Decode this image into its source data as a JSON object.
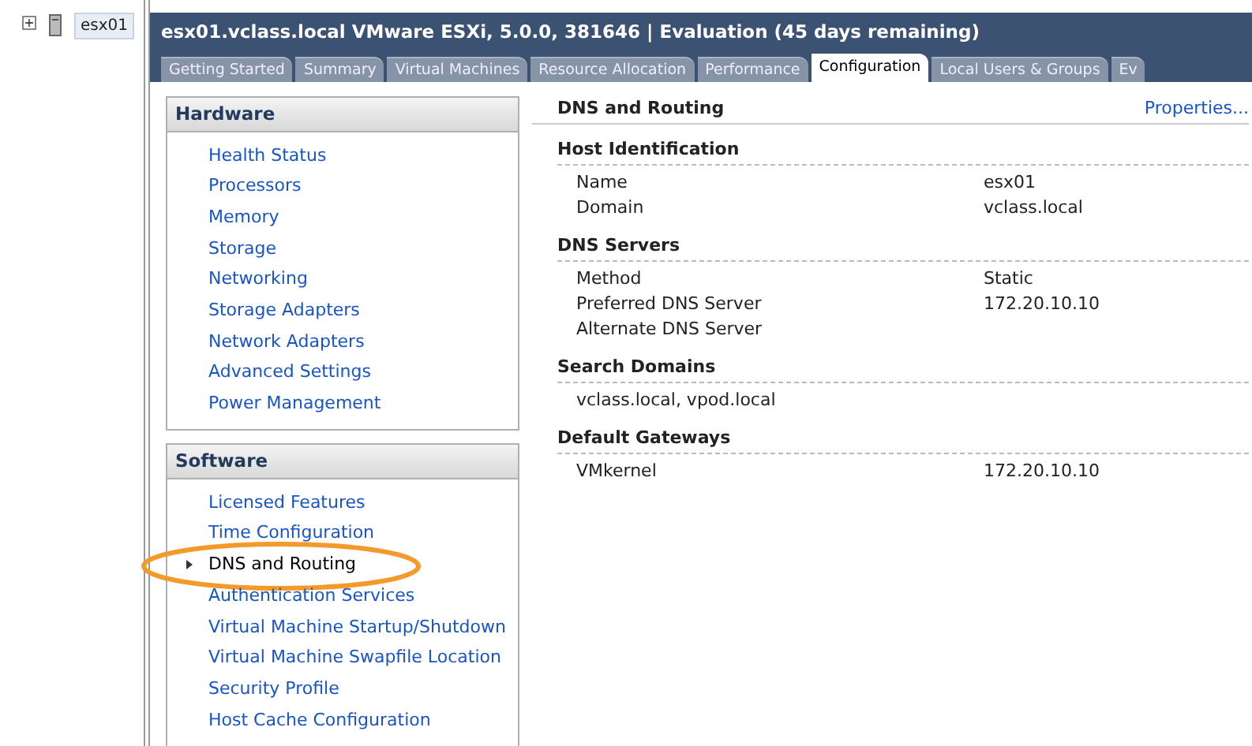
{
  "tree": {
    "expand_sign": "+",
    "host": "esx01"
  },
  "header": {
    "title": "esx01.vclass.local VMware ESXi, 5.0.0, 381646 | Evaluation (45 days remaining)"
  },
  "tabs": [
    {
      "label": "Getting Started",
      "selected": false
    },
    {
      "label": "Summary",
      "selected": false
    },
    {
      "label": "Virtual Machines",
      "selected": false
    },
    {
      "label": "Resource Allocation",
      "selected": false
    },
    {
      "label": "Performance",
      "selected": false
    },
    {
      "label": "Configuration",
      "selected": true
    },
    {
      "label": "Local Users & Groups",
      "selected": false
    },
    {
      "label": "Ev",
      "selected": false
    }
  ],
  "nav_sections": [
    {
      "title": "Hardware",
      "items": [
        {
          "label": "Health Status",
          "selected": false
        },
        {
          "label": "Processors",
          "selected": false
        },
        {
          "label": "Memory",
          "selected": false
        },
        {
          "label": "Storage",
          "selected": false
        },
        {
          "label": "Networking",
          "selected": false
        },
        {
          "label": "Storage Adapters",
          "selected": false
        },
        {
          "label": "Network Adapters",
          "selected": false
        },
        {
          "label": "Advanced Settings",
          "selected": false
        },
        {
          "label": "Power Management",
          "selected": false
        }
      ]
    },
    {
      "title": "Software",
      "items": [
        {
          "label": "Licensed Features",
          "selected": false
        },
        {
          "label": "Time Configuration",
          "selected": false
        },
        {
          "label": "DNS and Routing",
          "selected": true,
          "highlighted": true
        },
        {
          "label": "Authentication Services",
          "selected": false
        },
        {
          "label": "Virtual Machine Startup/Shutdown",
          "selected": false
        },
        {
          "label": "Virtual Machine Swapfile Location",
          "selected": false
        },
        {
          "label": "Security Profile",
          "selected": false
        },
        {
          "label": "Host Cache Configuration",
          "selected": false
        }
      ]
    }
  ],
  "detail": {
    "title": "DNS and Routing",
    "properties_link": "Properties...",
    "groups": [
      {
        "title": "Host Identification",
        "rows": [
          {
            "label": "Name",
            "value": "esx01"
          },
          {
            "label": "Domain",
            "value": "vclass.local"
          }
        ]
      },
      {
        "title": "DNS Servers",
        "rows": [
          {
            "label": "Method",
            "value": "Static"
          },
          {
            "label": "Preferred DNS Server",
            "value": "172.20.10.10"
          },
          {
            "label": "Alternate DNS Server"
          }
        ]
      },
      {
        "title": "Search Domains",
        "rows": [
          {
            "label": "vclass.local, vpod.local"
          }
        ]
      },
      {
        "title": "Default Gateways",
        "rows": [
          {
            "label": "VMkernel",
            "value": "172.20.10.10"
          }
        ]
      }
    ]
  }
}
